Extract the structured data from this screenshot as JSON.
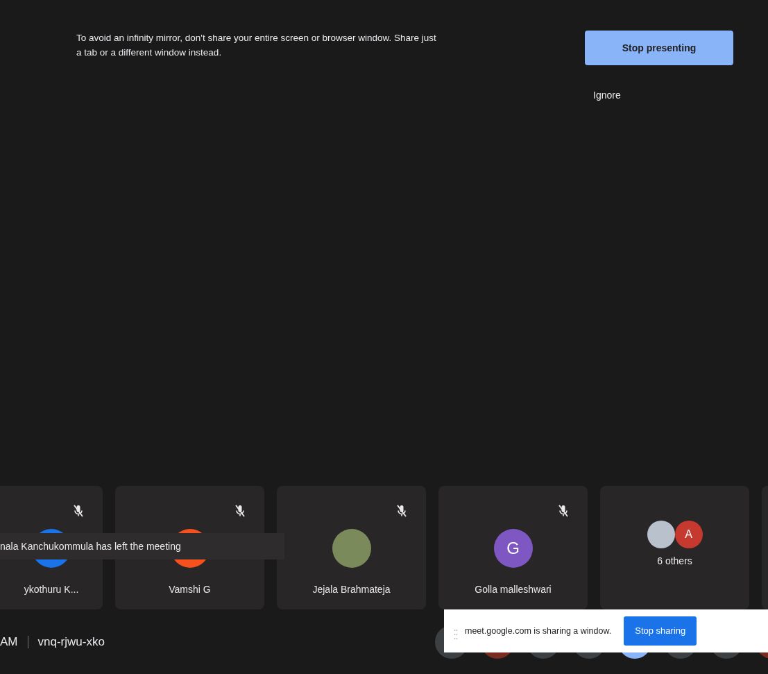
{
  "warning": {
    "message": "To avoid an infinity mirror, don't share your entire screen or browser window. Share just a tab or a different window instead.",
    "primary_button": "Stop presenting",
    "secondary_button": "Ignore"
  },
  "tiles": [
    {
      "kind": "letter",
      "name": "ykothuru K...",
      "muted": true,
      "color": "#1a73e8"
    },
    {
      "kind": "letter",
      "name": "Vamshi G",
      "muted": true,
      "color": "#f4511e"
    },
    {
      "kind": "photo",
      "name": "Jejala Brahmateja",
      "muted": true
    },
    {
      "kind": "letter",
      "name": "Golla malleshwari",
      "muted": true,
      "color": "#7e57c2",
      "initial": "G"
    },
    {
      "kind": "group",
      "name": "6 others",
      "muted": false,
      "initial": "A",
      "color": "#c5392f"
    },
    {
      "kind": "blank",
      "muted": false
    }
  ],
  "toast": "nala Kanchukommula has left the meeting",
  "meeting": {
    "time": "AM",
    "code": "vnq-rjwu-xko"
  },
  "controls": [
    {
      "kind": "mic"
    },
    {
      "kind": "red"
    },
    {
      "kind": "plain"
    },
    {
      "kind": "plain"
    },
    {
      "kind": "blue"
    },
    {
      "kind": "plain"
    },
    {
      "kind": "plain"
    },
    {
      "kind": "red"
    }
  ],
  "share_bar": {
    "message": "meet.google.com is sharing a window.",
    "button": "Stop sharing"
  }
}
